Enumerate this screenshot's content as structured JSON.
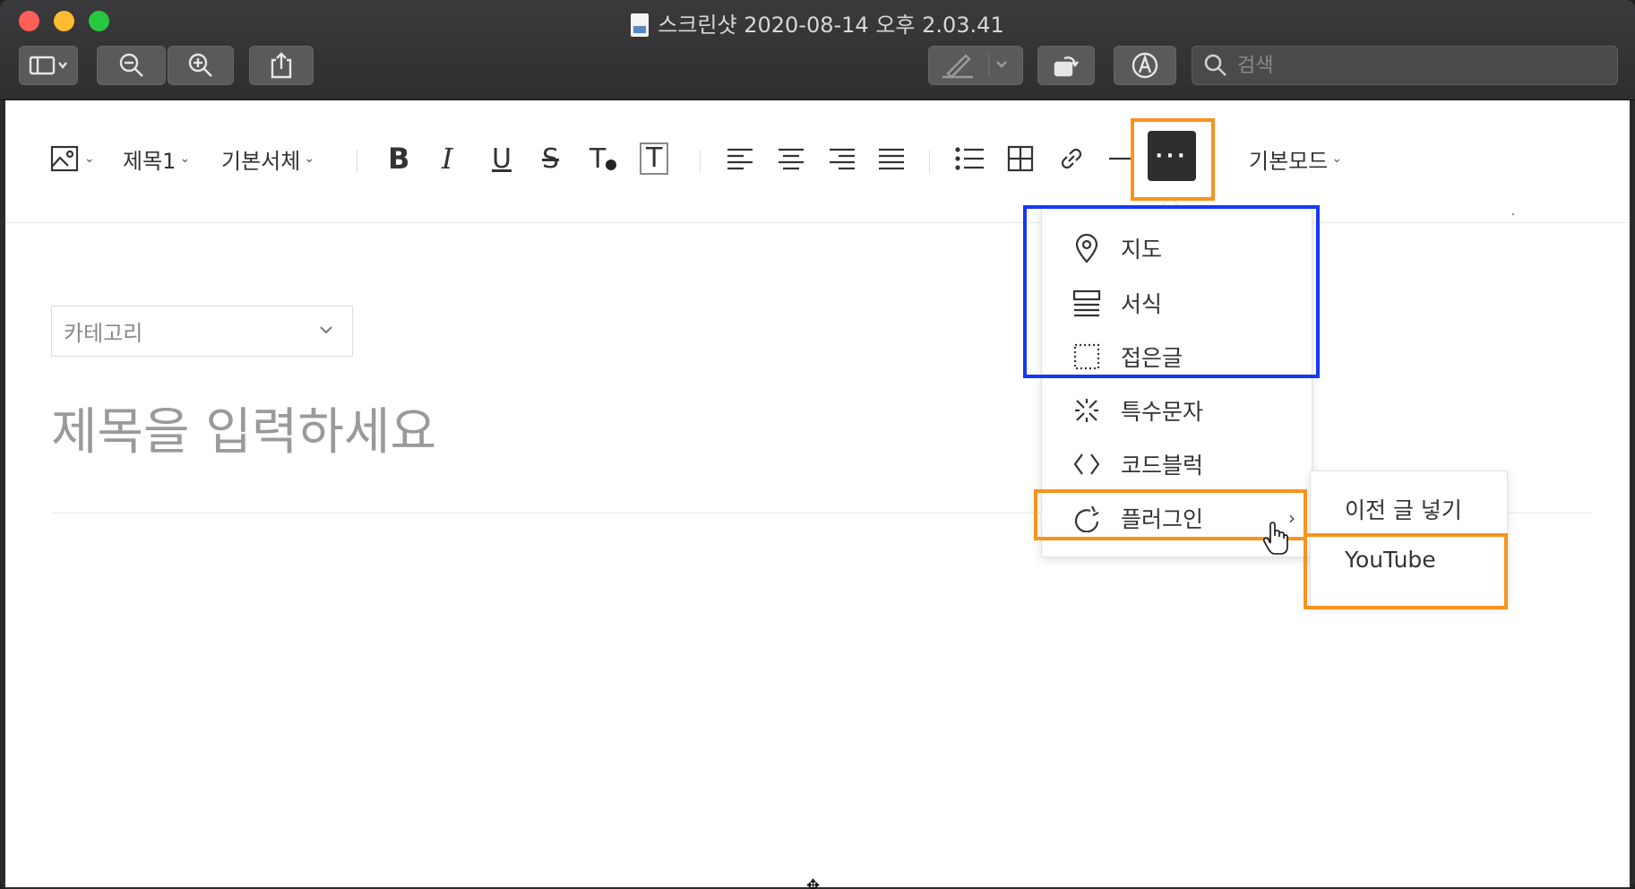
{
  "window": {
    "title": "스크린샷 2020-08-14 오후 2.03.41"
  },
  "toolbar": {
    "search_placeholder": "검색"
  },
  "editor_toolbar": {
    "heading_label": "제목1",
    "font_label": "기본서체",
    "mode_label": "기본모드",
    "more_label": "···",
    "bold": "B",
    "italic": "I",
    "underline": "U",
    "strike": "S",
    "text_color": "T",
    "text_bg": "T"
  },
  "editor": {
    "category_placeholder": "카테고리",
    "title_placeholder": "제목을 입력하세요"
  },
  "more_menu": {
    "items": [
      {
        "label": "지도",
        "icon": "map-pin-icon"
      },
      {
        "label": "서식",
        "icon": "format-icon"
      },
      {
        "label": "접은글",
        "icon": "fold-icon"
      },
      {
        "label": "특수문자",
        "icon": "special-char-icon"
      },
      {
        "label": "코드블럭",
        "icon": "code-icon"
      },
      {
        "label": "플러그인",
        "icon": "plugin-icon"
      }
    ]
  },
  "plugin_submenu": {
    "items": [
      "이전 글 넣기",
      "YouTube"
    ]
  },
  "colors": {
    "highlight_blue": "#1638f5",
    "highlight_orange": "#f7941d"
  }
}
